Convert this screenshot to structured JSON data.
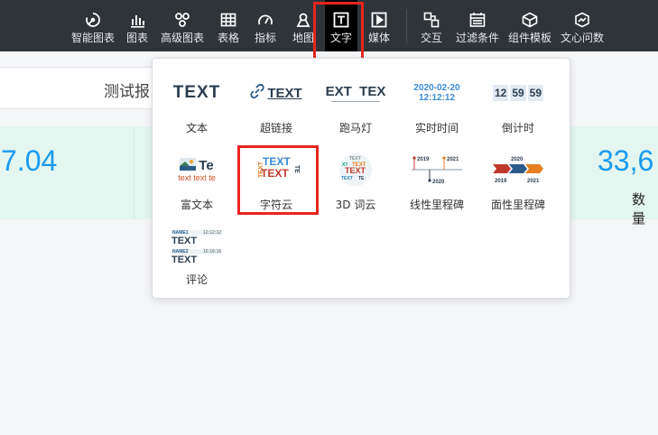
{
  "toolbar": {
    "items": [
      {
        "label": "智能图表",
        "icon": "smart-chart-icon"
      },
      {
        "label": "图表",
        "icon": "bar-chart-icon"
      },
      {
        "label": "高级图表",
        "icon": "advanced-chart-icon"
      },
      {
        "label": "表格",
        "icon": "table-icon"
      },
      {
        "label": "指标",
        "icon": "gauge-icon"
      },
      {
        "label": "地图",
        "icon": "map-pin-icon"
      },
      {
        "label": "文字",
        "icon": "text-icon",
        "active": true
      },
      {
        "label": "媒体",
        "icon": "media-play-icon"
      },
      {
        "label": "交互",
        "icon": "interaction-icon"
      },
      {
        "label": "过滤条件",
        "icon": "filter-calendar-icon"
      },
      {
        "label": "组件模板",
        "icon": "component-template-icon"
      },
      {
        "label": "文心问数",
        "icon": "wenxin-icon"
      }
    ]
  },
  "background": {
    "report_title": "测试报",
    "kpi_left_value": "7.04",
    "kpi_right_value": "33,6",
    "kpi_right_label": "数量"
  },
  "text_menu": {
    "items": [
      {
        "name": "文本",
        "preview": "TEXT"
      },
      {
        "name": "超链接",
        "preview": "TEXT"
      },
      {
        "name": "跑马灯",
        "preview": "EXT  TEX"
      },
      {
        "name": "实时时间",
        "preview_date": "2020-02-20",
        "preview_time": "12:12:12"
      },
      {
        "name": "倒计时",
        "preview_digits": [
          "12",
          "59",
          "59"
        ]
      },
      {
        "name": "富文本",
        "preview": "Te",
        "preview_sub": "text text te"
      },
      {
        "name": "字符云",
        "preview": "TEXT"
      },
      {
        "name": "3D 词云",
        "preview": "TEXT"
      },
      {
        "name": "线性里程碑",
        "preview_years": [
          "2019",
          "2021",
          "2020"
        ]
      },
      {
        "name": "面性里程碑",
        "preview_years": [
          "2020",
          "2019",
          "2021"
        ]
      },
      {
        "name": "评论",
        "preview_rows": [
          {
            "user": "NAME1",
            "time": "12:12:12",
            "text": "TEXT"
          },
          {
            "user": "NAME2",
            "time": "16:16:16",
            "text": "TEXT"
          }
        ]
      }
    ]
  },
  "colors": {
    "toolbar_bg": "#2f3439",
    "highlight": "#e8251f",
    "kpi_value": "#1a9bf0",
    "kpi_band": "#e3f6ef"
  }
}
